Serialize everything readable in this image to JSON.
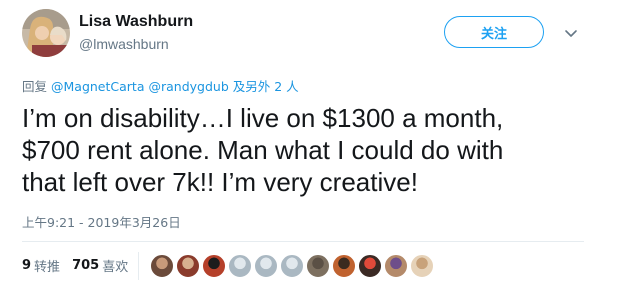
{
  "user": {
    "display_name": "Lisa Washburn",
    "handle": "@lmwashburn"
  },
  "follow_label": "关注",
  "reply": {
    "prefix": "回复",
    "mentions": [
      "@MagnetCarta",
      "@randygdub"
    ],
    "suffix": "及另外 2 人"
  },
  "tweet": {
    "text": "I’m on disability…I live on $1300 a month,\n$700 rent alone. Man what I could do with\nthat left over 7k!! I’m very creative!",
    "timestamp": "上午9:21 - 2019年3月26日"
  },
  "stats": {
    "retweets_count": "9",
    "retweets_label": "转推",
    "likes_count": "705",
    "likes_label": "喜欢"
  },
  "colors": {
    "accent": "#1da1f2",
    "link": "#1b95e0",
    "muted": "#657786",
    "text": "#14171a",
    "divider": "#e6ecf0"
  },
  "icons": {
    "more": "chevron-down-icon"
  },
  "liker_avatar_colors": [
    [
      "#6b4a3a",
      "#c89a7a"
    ],
    [
      "#8a3b2c",
      "#d7b08f"
    ],
    [
      "#b5402a",
      "#1c1c1c"
    ],
    [
      "#aab8c2",
      "#e1e8ed"
    ],
    [
      "#aab8c2",
      "#e1e8ed"
    ],
    [
      "#aab8c2",
      "#e1e8ed"
    ],
    [
      "#7d7060",
      "#5b5045"
    ],
    [
      "#c0622f",
      "#3a2a1f"
    ],
    [
      "#3b2a24",
      "#e04a3a"
    ],
    [
      "#b48a6a",
      "#6e4e8a"
    ],
    [
      "#e6d2b8",
      "#c8a27a"
    ]
  ]
}
